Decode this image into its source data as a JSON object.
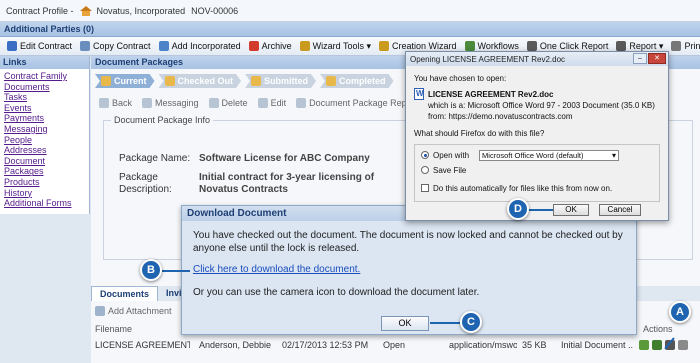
{
  "titlebar": {
    "profile": "Contract Profile -",
    "company": "Novatus, Incorporated",
    "contract_id": "NOV-00006"
  },
  "additional_parties": "Additional Parties (0)",
  "toolbar": [
    {
      "label": "Edit Contract",
      "icon": "edit-icon",
      "color": "#3a6fc4"
    },
    {
      "label": "Copy Contract",
      "icon": "copy-icon",
      "color": "#6a8fbf"
    },
    {
      "label": "Add Incorporated",
      "icon": "add-incorporated-icon",
      "color": "#4d84c9"
    },
    {
      "label": "Archive",
      "icon": "archive-icon",
      "color": "#d23c2c"
    },
    {
      "label": "Wizard Tools ▾",
      "icon": "wizard-icon",
      "color": "#c99a1e"
    },
    {
      "label": "Creation Wizard",
      "icon": "creation-wizard-icon",
      "color": "#c99a1e"
    },
    {
      "label": "Workflows",
      "icon": "workflows-icon",
      "color": "#4c8a3c"
    },
    {
      "label": "One Click Report",
      "icon": "report-icon",
      "color": "#5b5b5b"
    },
    {
      "label": "Report ▾",
      "icon": "report-menu-icon",
      "color": "#5b5b5b"
    },
    {
      "label": "Print",
      "icon": "print-icon",
      "color": "#777777"
    }
  ],
  "links": {
    "title": "Links",
    "items": [
      "Contract Family",
      "Documents",
      "Tasks",
      "Events",
      "Payments",
      "Messaging",
      "People",
      "Addresses",
      "Document Packages",
      "Products",
      "History",
      "Additional Forms"
    ]
  },
  "main": {
    "title": "Document Packages",
    "statuses": [
      {
        "label": "Current",
        "active": true
      },
      {
        "label": "Checked Out",
        "active": false
      },
      {
        "label": "Submitted",
        "active": false
      },
      {
        "label": "Completed",
        "active": false
      }
    ],
    "sub_toolbar": [
      "Back",
      "Messaging",
      "Delete",
      "Edit",
      "Document Package Report"
    ],
    "info_title": "Document Package Info",
    "package_name_label": "Package Name:",
    "package_name": "Software License for ABC Company",
    "package_desc_label": "Package Description:",
    "package_desc_line1": "Initial contract for 3-year licensing of",
    "package_desc_line2": "Novatus Contracts",
    "tabs": [
      "Documents",
      "Invi"
    ],
    "add_attachment": "Add Attachment",
    "grid_headers": {
      "filename": "Filename",
      "actions": "Actions"
    },
    "row": {
      "filename": "LICENSE AGREEMENT ...",
      "person": "Anderson, Debbie",
      "date": "02/17/2013 12:53 PM",
      "state": "Open",
      "mime": "application/mswo...",
      "size": "35 KB",
      "doc_type": "Initial Document ..."
    }
  },
  "download_dialog": {
    "title": "Download Document",
    "message": "You have checked out the document. The document is now locked and cannot be checked out by anyone else until the lock is released.",
    "link": "Click here to download the document.",
    "alt": "Or you can use the camera icon to download the document later.",
    "ok": "OK"
  },
  "firefox_dialog": {
    "title": "Opening LICENSE AGREEMENT Rev2.doc",
    "chosen": "You have chosen to open:",
    "filename": "LICENSE AGREEMENT Rev2.doc",
    "which_is": "which is a: Microsoft Office Word 97 - 2003 Document (35.0 KB)",
    "from": "from: https://demo.novatuscontracts.com",
    "question": "What should Firefox do with this file?",
    "open_with": "Open with",
    "open_with_app": "Microsoft Office Word (default)",
    "save_file": "Save File",
    "auto": "Do this automatically for files like this from now on.",
    "ok": "OK",
    "cancel": "Cancel"
  },
  "markers": [
    "A",
    "B",
    "C",
    "D"
  ],
  "colors": {
    "marker": "#1f64b0",
    "header_text": "#1d3f74",
    "link": "#551a8b"
  }
}
